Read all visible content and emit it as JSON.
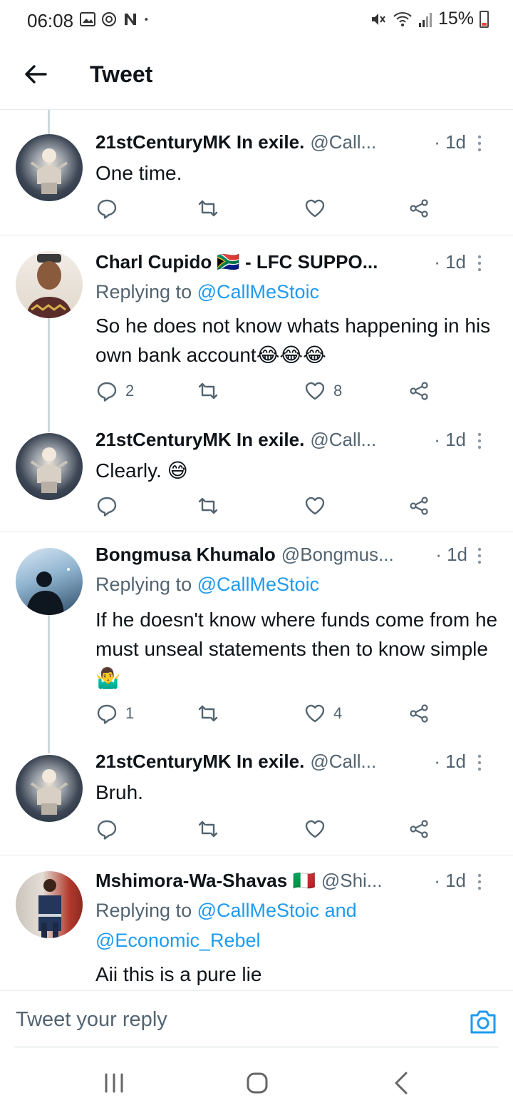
{
  "status_bar": {
    "time": "06:08",
    "battery": "15%",
    "left_icons": [
      "gallery-icon",
      "at-sign-icon",
      "n-logo-icon",
      "dot-icon"
    ],
    "right_icons": [
      "mute-icon",
      "wifi-icon",
      "signal-icon",
      "battery-icon"
    ]
  },
  "header": {
    "title": "Tweet",
    "back_icon": "arrow-left-icon"
  },
  "tweets": [
    {
      "name": "21stCenturyMK In exile.",
      "handle": "@Call...",
      "time": "· 1d",
      "text": "One time.",
      "replies": "",
      "likes": ""
    },
    {
      "name": "Charl Cupido 🇿🇦 - LFC SUPPO...",
      "handle": "",
      "time": "· 1d",
      "replying_label": "Replying to",
      "replying_to": "@CallMeStoic",
      "text": "So he does not know whats happening in his own bank account😂😂😂",
      "replies": "2",
      "likes": "8"
    },
    {
      "name": "21stCenturyMK In exile.",
      "handle": "@Call...",
      "time": "· 1d",
      "text": "Clearly. 😅",
      "replies": "",
      "likes": ""
    },
    {
      "name": "Bongmusa Khumalo",
      "handle": "@Bongmus...",
      "time": "· 1d",
      "replying_label": "Replying to",
      "replying_to": "@CallMeStoic",
      "text": "If he doesn't know where funds come from he must unseal statements then to know simple🤷‍♂️",
      "replies": "1",
      "likes": "4"
    },
    {
      "name": "21stCenturyMK In exile.",
      "handle": "@Call...",
      "time": "· 1d",
      "text": "Bruh.",
      "replies": "",
      "likes": ""
    },
    {
      "name": "Mshimora-Wa-Shavas 🇮🇹",
      "handle": "@Shi...",
      "time": "· 1d",
      "replying_label": "Replying to",
      "replying_to": "@CallMeStoic and",
      "replying_to_2": "@Economic_Rebel",
      "text": "Aii this is a pure lie"
    }
  ],
  "reply_bar": {
    "placeholder": "Tweet your reply"
  },
  "colors": {
    "accent": "#1d9bf0",
    "text": "#0f1419",
    "secondary": "#536471",
    "divider": "#e6ecf0"
  }
}
